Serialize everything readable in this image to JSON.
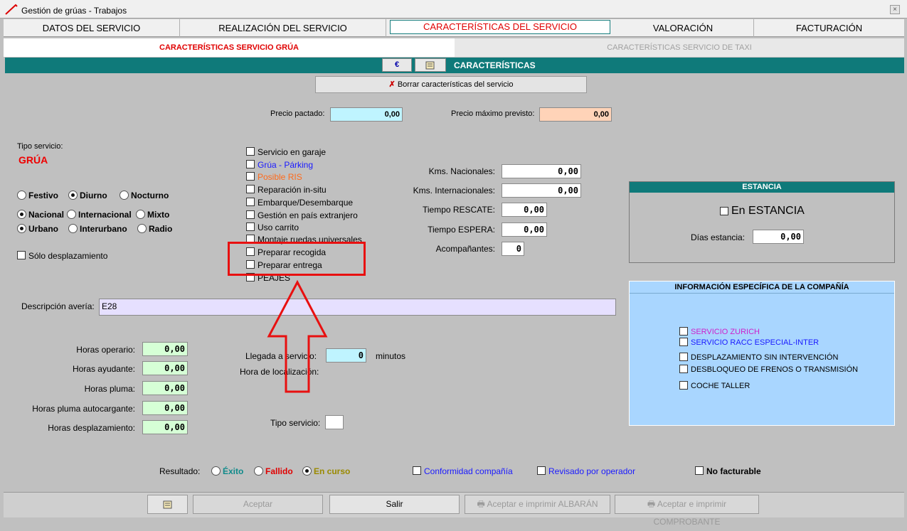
{
  "window": {
    "title": "Gestión de grúas - Trabajos",
    "close": "×"
  },
  "tabs": [
    {
      "label": "DATOS DEL SERVICIO"
    },
    {
      "label": "REALIZACIÓN DEL SERVICIO"
    },
    {
      "label": "CARACTERÍSTICAS DEL SERVICIO"
    },
    {
      "label": "VALORACIÓN"
    },
    {
      "label": "FACTURACIÓN"
    }
  ],
  "subtabs": [
    {
      "label": "CARACTERÍSTICAS SERVICIO GRÚA"
    },
    {
      "label": "CARACTERÍSTICAS SERVICIO DE TAXI"
    }
  ],
  "toolbar": {
    "euro_label": "€",
    "section_title": "CARACTERÍSTICAS",
    "clear_label": "Borrar características del servicio"
  },
  "prices": {
    "agreed_label": "Precio pactado:",
    "agreed_value": "0,00",
    "max_label": "Precio máximo previsto:",
    "max_value": "0,00"
  },
  "service_type": {
    "label": "Tipo servicio:",
    "value": "GRÚA"
  },
  "radios": {
    "festivo": "Festivo",
    "diurno": "Diurno",
    "nocturno": "Nocturno",
    "nacional": "Nacional",
    "internacional": "Internacional",
    "mixto": "Mixto",
    "urbano": "Urbano",
    "interurbano": "Interurbano",
    "radio": "Radio"
  },
  "only_displacement": "Sólo desplazamiento",
  "checklist": [
    {
      "label": "Servicio en garaje",
      "color": "#000000"
    },
    {
      "label": "Grúa - Párking",
      "color": "#1a1aff"
    },
    {
      "label": "Posible RIS",
      "color": "#ff6a1a"
    },
    {
      "label": "Reparación in-situ",
      "color": "#000000"
    },
    {
      "label": "Embarque/Desembarque",
      "color": "#000000"
    },
    {
      "label": "Gestión en país extranjero",
      "color": "#000000"
    },
    {
      "label": "Uso carrito",
      "color": "#000000"
    },
    {
      "label": "Montaje ruedas universales",
      "color": "#000000"
    },
    {
      "label": "Preparar recogida",
      "color": "#000000"
    },
    {
      "label": "Preparar entrega",
      "color": "#000000"
    },
    {
      "label": "PEAJES",
      "color": "#000000"
    }
  ],
  "kms": {
    "nacionales_label": "Kms. Nacionales:",
    "nacionales_value": "0,00",
    "internacionales_label": "Kms. Internacionales:",
    "internacionales_value": "0,00",
    "rescate_label": "Tiempo RESCATE:",
    "rescate_value": "0,00",
    "espera_label": "Tiempo ESPERA:",
    "espera_value": "0,00",
    "acomp_label": "Acompañantes:",
    "acomp_value": "0"
  },
  "estancia": {
    "title": "ESTANCIA",
    "checkbox": "En ESTANCIA",
    "days_label": "Días estancia:",
    "days_value": "0,00"
  },
  "company": {
    "title": "INFORMACIÓN ESPECÍFICA DE LA COMPAÑÍA",
    "items": [
      {
        "label": "SERVICIO ZURICH",
        "color": "#cc22cc"
      },
      {
        "label": "SERVICIO RACC ESPECIAL-INTER",
        "color": "#1a1aff"
      },
      {
        "label": "DESPLAZAMIENTO SIN INTERVENCIÓN",
        "color": "#000000"
      },
      {
        "label": "DESBLOQUEO DE FRENOS O TRANSMISIÓN",
        "color": "#000000"
      },
      {
        "label": "COCHE TALLER",
        "color": "#000000"
      }
    ]
  },
  "description": {
    "label": "Descripción avería:",
    "value": "E28"
  },
  "hours": [
    {
      "label": "Horas operario:",
      "value": "0,00"
    },
    {
      "label": "Horas ayudante:",
      "value": "0,00"
    },
    {
      "label": "Horas pluma:",
      "value": "0,00"
    },
    {
      "label": "Horas pluma autocargante:",
      "value": "0,00"
    },
    {
      "label": "Horas desplazamiento:",
      "value": "0,00"
    }
  ],
  "arrival": {
    "label": "Llegada a servicio:",
    "value": "0",
    "unit": "minutos",
    "location_label": "Hora de localización:"
  },
  "tipo_servicio_small": "Tipo servicio:",
  "result": {
    "label": "Resultado:",
    "exito": "Éxito",
    "fallido": "Fallido",
    "en_curso": "En curso",
    "conformidad": "Conformidad compañía",
    "revisado": "Revisado por operador",
    "no_facturable": "No facturable"
  },
  "bottom": {
    "aceptar": "Aceptar",
    "salir": "Salir",
    "albaran": "Aceptar e imprimir ALBARÁN",
    "comprobante": "Aceptar e imprimir COMPROBANTE"
  },
  "colors": {
    "teal": "#0f7a7a",
    "accent_red": "#e00000",
    "company_panel": "#a9d6ff"
  }
}
